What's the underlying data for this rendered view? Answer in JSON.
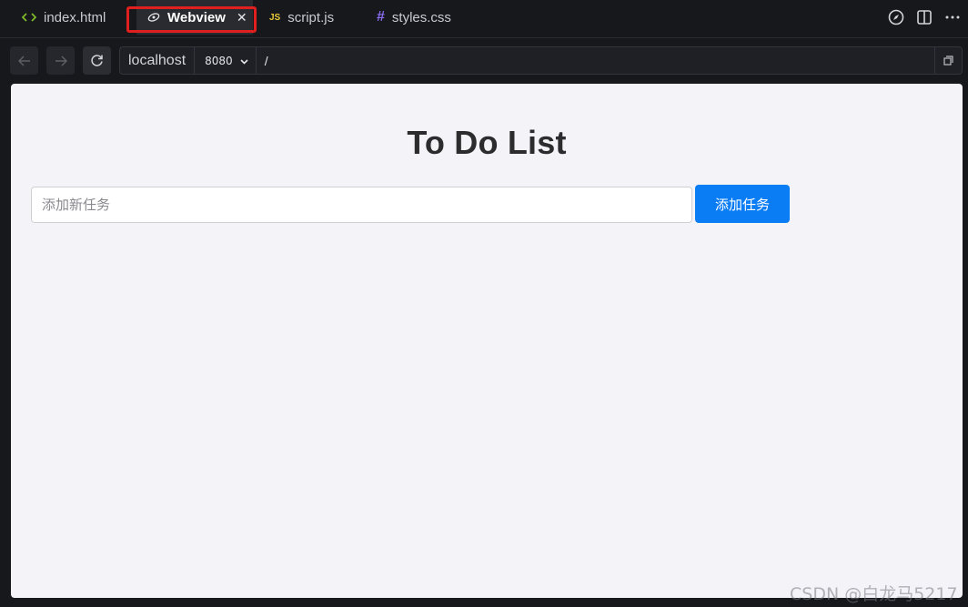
{
  "tabs": [
    {
      "label": "index.html",
      "icon": "code-icon",
      "icon_color": "#7fba2a"
    },
    {
      "label": "Webview",
      "icon": "eye-icon",
      "active": true,
      "close_glyph": "✕"
    },
    {
      "label": "script.js",
      "icon": "js-icon",
      "icon_text": "JS",
      "icon_color": "#e8c93a"
    },
    {
      "label": "styles.css",
      "icon": "hash-icon",
      "icon_text": "#",
      "icon_color": "#8b6cf0"
    }
  ],
  "toolbar_right": {
    "icons": [
      "compass-icon",
      "split-editor-icon",
      "more-icon"
    ]
  },
  "urlbar": {
    "back_enabled": false,
    "forward_enabled": false,
    "host": "localhost",
    "port": "8080",
    "path": "/"
  },
  "page": {
    "title": "To Do List",
    "input_placeholder": "添加新任务",
    "input_value": "",
    "add_button_label": "添加任务",
    "accent_color": "#0a7df5"
  },
  "watermark": "CSDN @白龙马5217"
}
